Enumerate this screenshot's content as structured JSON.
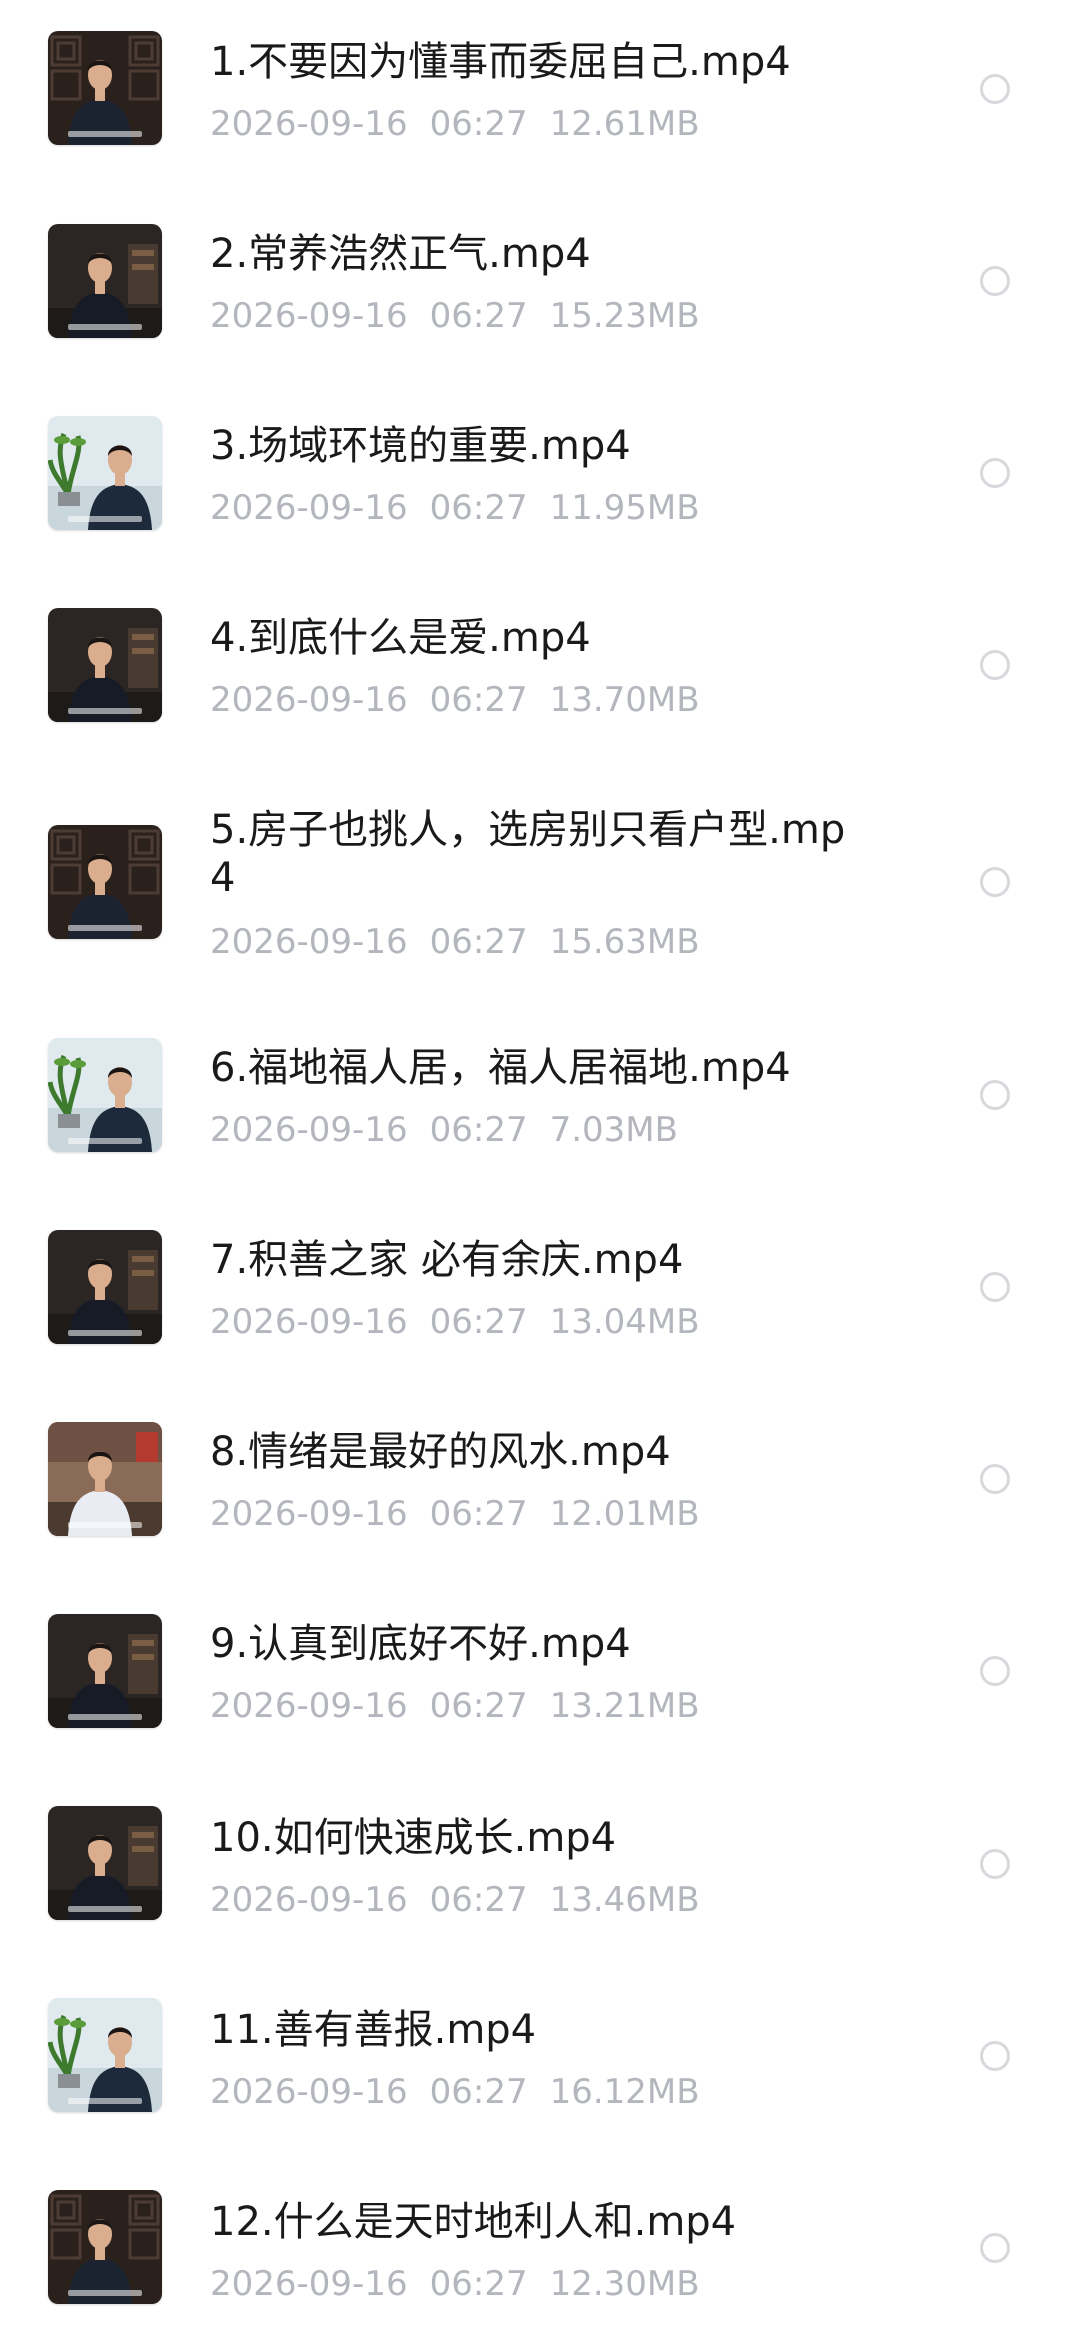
{
  "files": [
    {
      "name": "1.不要因为懂事而委屈自己.mp4",
      "date": "2026-09-16",
      "time": "06:27",
      "size": "12.61MB",
      "thumb_style": "dark-lattice",
      "selected": false
    },
    {
      "name": "2.常养浩然正气.mp4",
      "date": "2026-09-16",
      "time": "06:27",
      "size": "15.23MB",
      "thumb_style": "dark-room",
      "selected": false
    },
    {
      "name": "3.场域环境的重要.mp4",
      "date": "2026-09-16",
      "time": "06:27",
      "size": "11.95MB",
      "thumb_style": "light-plant",
      "selected": false
    },
    {
      "name": "4.到底什么是爱.mp4",
      "date": "2026-09-16",
      "time": "06:27",
      "size": "13.70MB",
      "thumb_style": "dark-room",
      "selected": false
    },
    {
      "name": "5.房子也挑人，选房别只看户型.mp4",
      "date": "2026-09-16",
      "time": "06:27",
      "size": "15.63MB",
      "thumb_style": "dark-lattice",
      "selected": false
    },
    {
      "name": "6.福地福人居，福人居福地.mp4",
      "date": "2026-09-16",
      "time": "06:27",
      "size": "7.03MB",
      "thumb_style": "light-plant",
      "selected": false
    },
    {
      "name": "7.积善之家 必有余庆.mp4",
      "date": "2026-09-16",
      "time": "06:27",
      "size": "13.04MB",
      "thumb_style": "dark-room",
      "selected": false
    },
    {
      "name": "8.情绪是最好的风水.mp4",
      "date": "2026-09-16",
      "time": "06:27",
      "size": "12.01MB",
      "thumb_style": "warm-study",
      "selected": false
    },
    {
      "name": "9.认真到底好不好.mp4",
      "date": "2026-09-16",
      "time": "06:27",
      "size": "13.21MB",
      "thumb_style": "dark-room",
      "selected": false
    },
    {
      "name": "10.如何快速成长.mp4",
      "date": "2026-09-16",
      "time": "06:27",
      "size": "13.46MB",
      "thumb_style": "dark-room",
      "selected": false
    },
    {
      "name": "11.善有善报.mp4",
      "date": "2026-09-16",
      "time": "06:27",
      "size": "16.12MB",
      "thumb_style": "light-plant",
      "selected": false
    },
    {
      "name": "12.什么是天时地利人和.mp4",
      "date": "2026-09-16",
      "time": "06:27",
      "size": "12.30MB",
      "thumb_style": "dark-lattice",
      "selected": false
    }
  ],
  "colors": {
    "title_text": "#1a1a1a",
    "meta_text": "#b3b6bd",
    "radio_border": "#d6d8dc",
    "background": "#ffffff"
  },
  "icons": {
    "thumbnail": "video-thumbnail",
    "select": "radio-circle-icon"
  }
}
